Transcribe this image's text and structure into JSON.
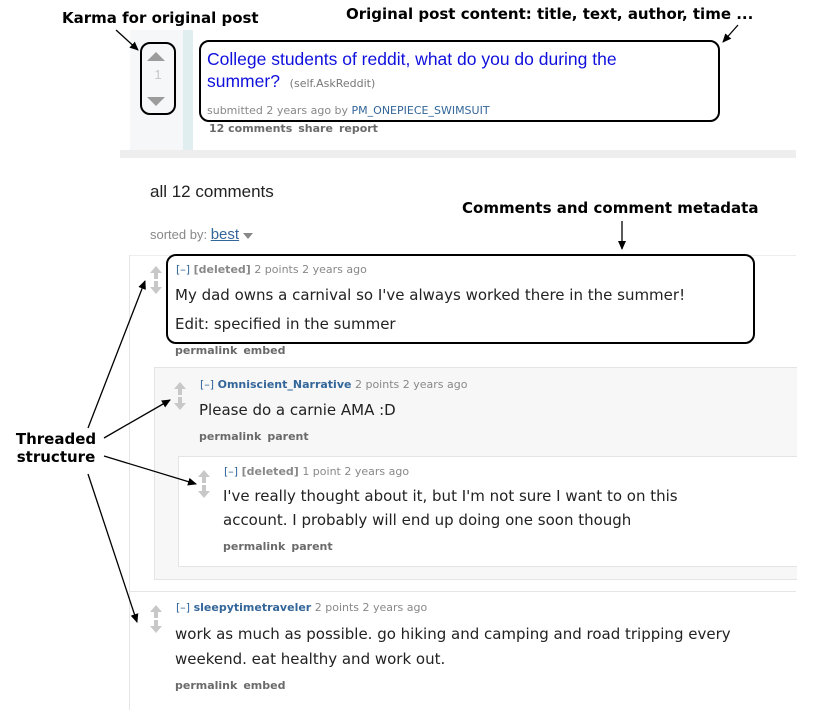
{
  "annotations": {
    "karma_label": "Karma for original post",
    "post_label": "Original post content: title, text, author, time ...",
    "comments_label": "Comments and comment metadata",
    "threaded_label_line1": "Threaded",
    "threaded_label_line2": "structure"
  },
  "post": {
    "score": "1",
    "title": "College students of reddit, what do you do during the summer?",
    "domain": "(self.AskReddit)",
    "tagline_prefix": "submitted 2 years ago by",
    "author": "PM_ONEPIECE_SWIMSUIT",
    "buttons": [
      "12 comments",
      "share",
      "report"
    ]
  },
  "comment_area": {
    "count_label": "all 12 comments",
    "sorted_by_label": "sorted by:",
    "sort_value": "best"
  },
  "comments": [
    {
      "toggle": "[–]",
      "author": "[deleted]",
      "points": "2 points",
      "time": "2 years ago",
      "body_lines": [
        "My dad owns a carnival so I've always worked there in the summer!",
        "Edit: specified in the summer"
      ],
      "buttons": [
        "permalink",
        "embed"
      ]
    },
    {
      "toggle": "[–]",
      "author": "Omniscient_Narrative",
      "points": "2 points",
      "time": "2 years ago",
      "body_lines": [
        "Please do a carnie AMA :D"
      ],
      "buttons": [
        "permalink",
        "parent"
      ]
    },
    {
      "toggle": "[–]",
      "author": "[deleted]",
      "points": "1 point",
      "time": "2 years ago",
      "body_lines": [
        "I've really thought about it, but I'm not sure I want to on this",
        "account. I probably will end up doing one soon though"
      ],
      "buttons": [
        "permalink",
        "parent"
      ]
    },
    {
      "toggle": "[–]",
      "author": "sleepytimetraveler",
      "points": "2 points",
      "time": "2 years ago",
      "body_lines": [
        "work as much as possible. go hiking and camping and road tripping every",
        "weekend. eat healthy and work out."
      ],
      "buttons": [
        "permalink",
        "embed"
      ]
    }
  ]
}
